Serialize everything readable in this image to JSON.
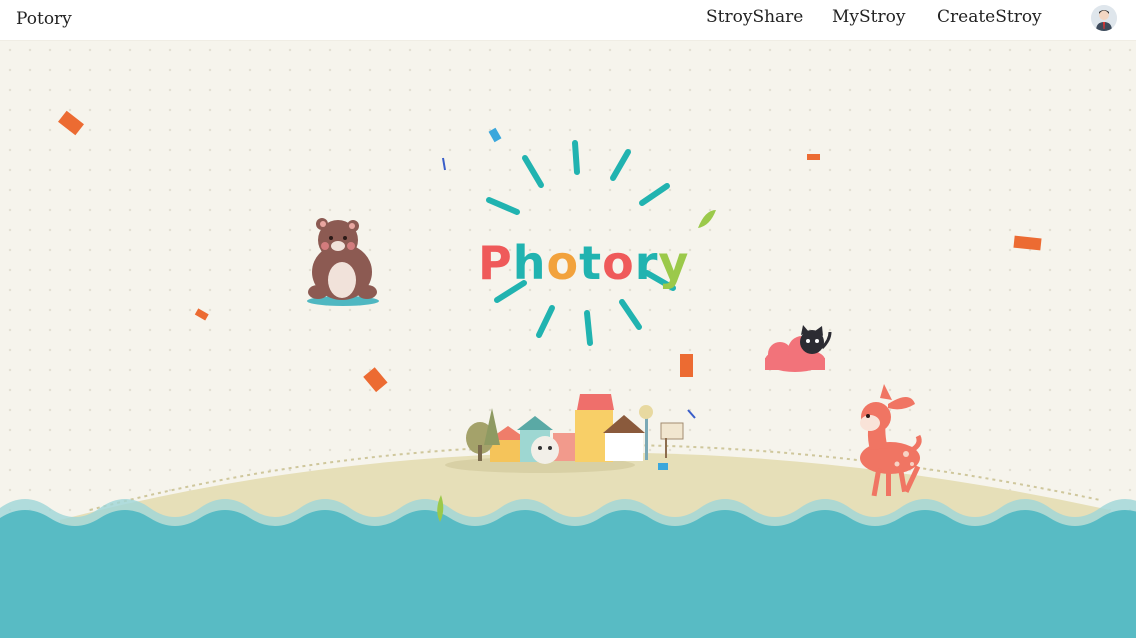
{
  "header": {
    "brand": "Potory",
    "nav": [
      {
        "label": "StroyShare"
      },
      {
        "label": "MyStroy"
      },
      {
        "label": "CreateStroy"
      }
    ],
    "avatar_icon": "user-avatar-icon"
  },
  "hero": {
    "logo_letters": [
      {
        "char": "P",
        "color": "#ef5a5a"
      },
      {
        "char": "h",
        "color": "#21b3b0"
      },
      {
        "char": "o",
        "color": "#f2a23c"
      },
      {
        "char": "t",
        "color": "#21b3b0"
      },
      {
        "char": "o",
        "color": "#ef5a5a"
      },
      {
        "char": "r",
        "color": "#21b3b0"
      },
      {
        "char": "y",
        "color": "#9bc94a"
      }
    ],
    "illustrations": [
      "bear",
      "cat-on-cloud",
      "deer",
      "village",
      "sea-waves",
      "confetti"
    ]
  },
  "colors": {
    "background": "#f6f4ec",
    "sea": "#58bbc4",
    "island": "#e6dfb8",
    "burst": "#21b3b0",
    "confetti": "#ec6b32"
  }
}
